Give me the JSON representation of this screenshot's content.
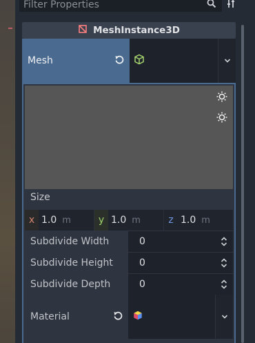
{
  "filter": {
    "placeholder": "Filter Properties"
  },
  "node": {
    "type": "MeshInstance3D"
  },
  "mesh": {
    "label": "Mesh"
  },
  "size": {
    "label": "Size",
    "x": {
      "axis": "x",
      "value": "1.0",
      "unit": "m"
    },
    "y": {
      "axis": "y",
      "value": "1.0",
      "unit": "m"
    },
    "z": {
      "axis": "z",
      "value": "1.0",
      "unit": "m"
    }
  },
  "subdivide": [
    {
      "label": "Subdivide Width",
      "value": "0"
    },
    {
      "label": "Subdivide Height",
      "value": "0"
    },
    {
      "label": "Subdivide Depth",
      "value": "0"
    }
  ],
  "material": {
    "label": "Material"
  },
  "colors": {
    "accent": "#4a6a8f",
    "axis_x": "#d4836e",
    "axis_y": "#9fd46e",
    "axis_z": "#7096e0",
    "node_icon": "#fc7f7f",
    "mesh_icon": "#a5d36e"
  },
  "icons": {
    "search": "search-icon",
    "tools": "tools-icon",
    "node": "mesh-instance-icon",
    "revert": "revert-icon",
    "mesh": "box-mesh-icon",
    "chevron": "chevron-down-icon",
    "light": "light-icon",
    "spinner": "spinner-arrows-icon",
    "material": "material-icon"
  }
}
